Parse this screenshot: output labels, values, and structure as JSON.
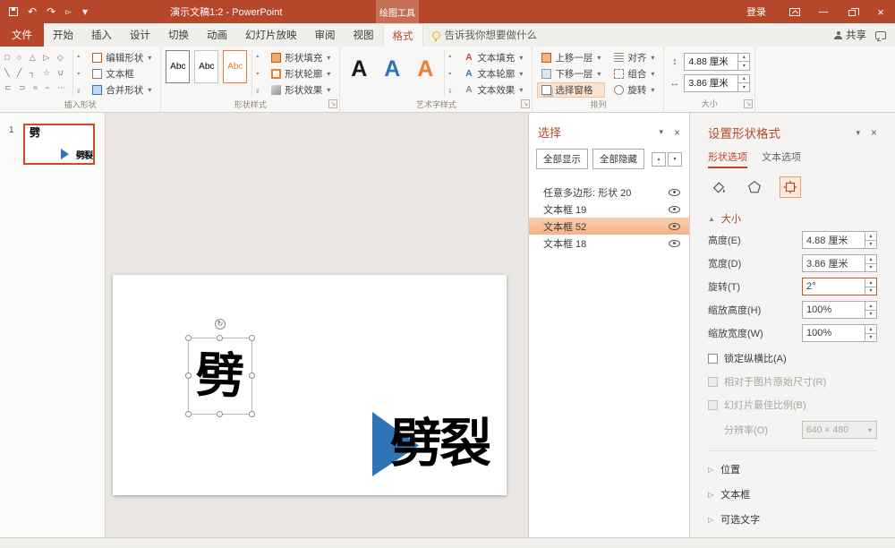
{
  "icons": {
    "dropdown": "▾",
    "undo": "↶",
    "redo": "↷",
    "scroll_up": "▴",
    "scroll_down": "▾",
    "more": "⊽",
    "launcher": "↘",
    "rotate": "↻",
    "resize_v": "↕",
    "resize_h": "↔",
    "collapsed": "▷",
    "expanded": "▲",
    "pane_menu": "▾",
    "pane_close": "×",
    "spin_up": "▴",
    "spin_down": "▾"
  },
  "titlebar": {
    "title": "演示文稿1:2 - PowerPoint",
    "contextual_header": "绘图工具",
    "sign_in": "登录"
  },
  "tabs": {
    "items": [
      {
        "label": "文件"
      },
      {
        "label": "开始"
      },
      {
        "label": "插入"
      },
      {
        "label": "设计"
      },
      {
        "label": "切换"
      },
      {
        "label": "动画"
      },
      {
        "label": "幻灯片放映"
      },
      {
        "label": "审阅"
      },
      {
        "label": "视图"
      },
      {
        "label": "格式"
      }
    ],
    "tell_me": "告诉我你想要做什么",
    "share": "共享"
  },
  "ribbon": {
    "insert_shapes": {
      "label": "插入形状",
      "rows": [
        "□ ○ △ ▷ ◇",
        "╲ ╱ ┐ ☆ ∪",
        "⊂ ⊃ ≈ ~ ⋯"
      ],
      "edit_shape": "编辑形状",
      "text_box": "文本框",
      "merge_shapes": "合并形状"
    },
    "shape_styles": {
      "label": "形状样式",
      "thumb": "Abc",
      "fill": "形状填充",
      "outline": "形状轮廓",
      "effects": "形状效果"
    },
    "wordart_styles": {
      "label": "艺术字样式",
      "letter": "A",
      "text_fill": "文本填充",
      "text_outline": "文本轮廓",
      "text_effects": "文本效果"
    },
    "arrange": {
      "label": "排列",
      "bring_forward": "上移一层",
      "send_backward": "下移一层",
      "selection_pane": "选择窗格",
      "align": "对齐",
      "group": "组合",
      "rotate": "旋转"
    },
    "size": {
      "label": "大小",
      "height_value": "4.88 厘米",
      "width_value": "3.86 厘米"
    }
  },
  "slide_panel": {
    "number": "1"
  },
  "slide": {
    "selected_text": "劈",
    "bottom_text": "劈裂"
  },
  "selection_pane": {
    "title": "选择",
    "show_all": "全部显示",
    "hide_all": "全部隐藏",
    "items": [
      {
        "label": "任意多边形: 形状 20"
      },
      {
        "label": "文本框 19"
      },
      {
        "label": "文本框 52"
      },
      {
        "label": "文本框 18"
      }
    ]
  },
  "format_pane": {
    "title": "设置形状格式",
    "tab_shape": "形状选项",
    "tab_text": "文本选项",
    "size_section": "大小",
    "size_fields": [
      {
        "label": "高度(E)",
        "value": "4.88 厘米"
      },
      {
        "label": "宽度(D)",
        "value": "3.86 厘米"
      },
      {
        "label": "旋转(T)",
        "value": "2°"
      },
      {
        "label": "缩放高度(H)",
        "value": "100%"
      },
      {
        "label": "缩放宽度(W)",
        "value": "100%"
      }
    ],
    "checkboxes": [
      {
        "label": "锁定纵横比(A)"
      },
      {
        "label": "相对于图片原始尺寸(R)"
      },
      {
        "label": "幻灯片最佳比例(B)"
      }
    ],
    "resolution_label": "分辨率(O)",
    "resolution_value": "640 × 480",
    "collapsed_sections": [
      {
        "label": "位置"
      },
      {
        "label": "文本框"
      },
      {
        "label": "可选文字"
      }
    ]
  },
  "colors": {
    "titlebar": "#b7472a",
    "accent": "#b7472a",
    "selection_highlight": "#f5b183",
    "triangle_blue": "#2e74b6"
  }
}
